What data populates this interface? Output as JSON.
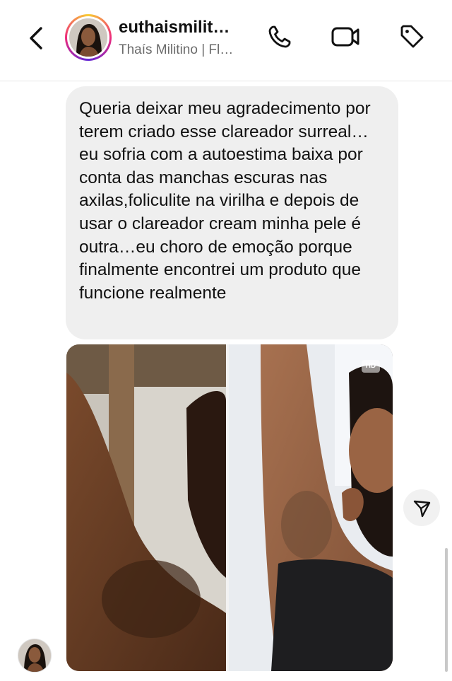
{
  "header": {
    "username": "euthaismilit…",
    "subtitle": "Thaís Militino | Fl…"
  },
  "message": {
    "text": "Queria deixar meu agradecimento por terem criado esse clareador surreal…eu sofria com a autoestima baixa por conta das manchas escuras nas axilas,foliculite na virilha e depois de usar o clareador cream minha pele é outra…eu choro de emoção porque finalmente encontrei um produto que funcione realmente"
  },
  "photo": {
    "badge": "HD"
  },
  "icons": {
    "back": "chevron-left-icon",
    "call": "phone-icon",
    "video": "video-camera-icon",
    "tag": "tag-icon",
    "share": "send-icon"
  },
  "colors": {
    "bubble": "#efefef",
    "text": "#111111",
    "secondary_text": "#6b6b6b",
    "story_ring": [
      "#f9ce34",
      "#ee2a7b",
      "#6228d7"
    ]
  }
}
